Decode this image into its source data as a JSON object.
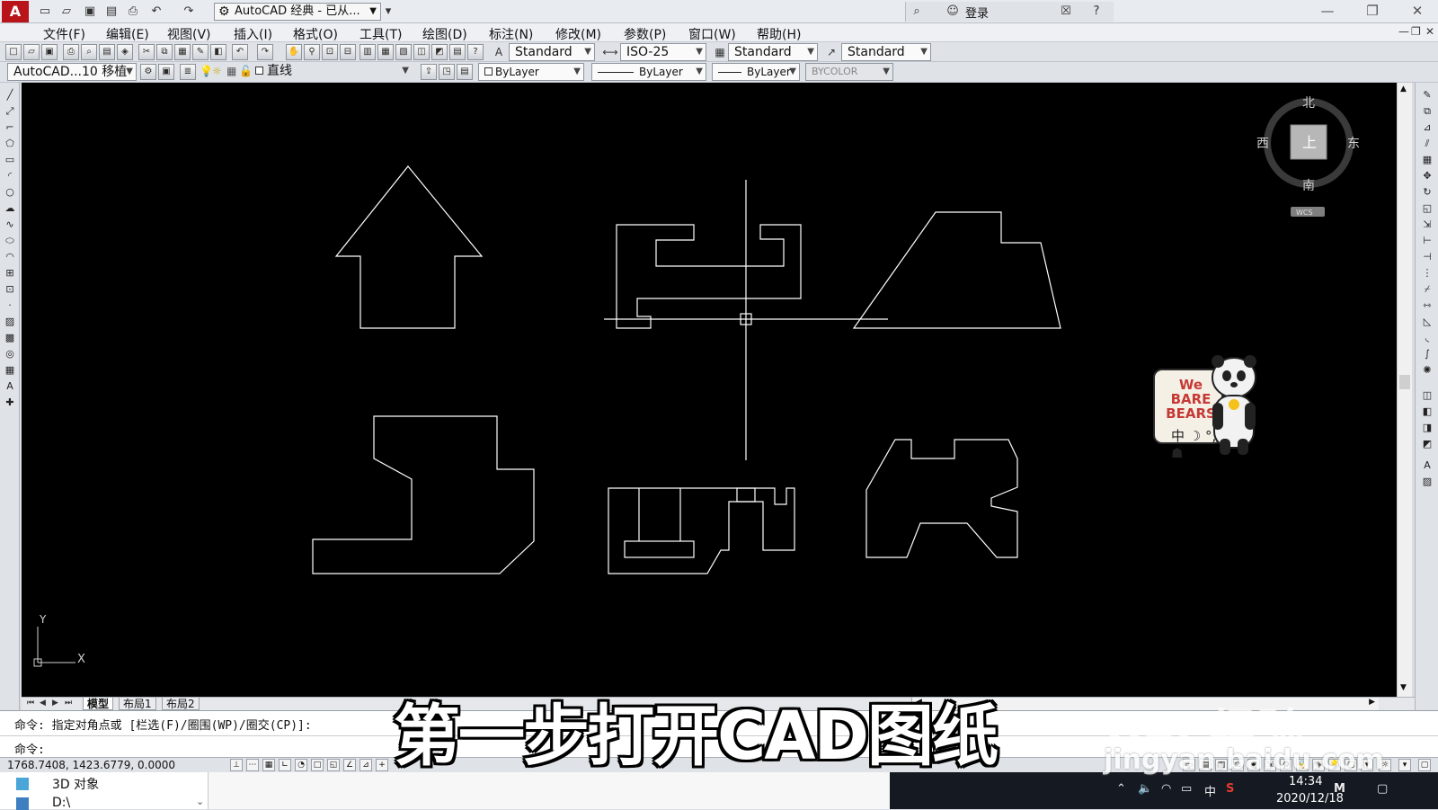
{
  "titlebar": {
    "app_icon": "A",
    "workspace": "AutoCAD 经典 - 已从...",
    "login": "登录",
    "win_controls": [
      "—",
      "❐",
      "✕"
    ]
  },
  "menu": {
    "items": [
      "文件(F)",
      "编辑(E)",
      "视图(V)",
      "插入(I)",
      "格式(O)",
      "工具(T)",
      "绘图(D)",
      "标注(N)",
      "修改(M)",
      "参数(P)",
      "窗口(W)",
      "帮助(H)"
    ],
    "doc_controls": [
      "—",
      "❐",
      "✕"
    ]
  },
  "styles_toolbar": {
    "text_style": "Standard",
    "dim_style": "ISO-25",
    "table_style": "Standard",
    "multileader_style": "Standard"
  },
  "layers_toolbar": {
    "workspace_combo": "AutoCAD...10 移植",
    "layer_combo": "直线",
    "color": "ByLayer",
    "linetype": "ByLayer",
    "lineweight": "ByLayer",
    "plot_style": "BYCOLOR"
  },
  "viewcube": {
    "north": "北",
    "south": "南",
    "west": "西",
    "east": "东",
    "face": "上",
    "wcs": "WCS"
  },
  "ucs": {
    "x": "X",
    "y": "Y"
  },
  "layout_tabs": [
    "模型",
    "布局1",
    "布局2"
  ],
  "command": {
    "history": "命令: 指定对角点或 [栏选(F)/圈围(WP)/圈交(CP)]:",
    "prompt": "命令:"
  },
  "status": {
    "coordinates": "1768.7408, 1423.6779, 0.0000"
  },
  "explorer": {
    "items": [
      "3D 对象",
      "D:\\"
    ]
  },
  "taskbar": {
    "ime": "中",
    "time": "14:34",
    "date": "2020/12/18"
  },
  "overlay": {
    "subtitle": "第一步打开CAD图纸",
    "watermark_logo": "Bai 经验",
    "watermark_url": "jingyan.baidu.com",
    "sticker_brand": "We BARE BEARS",
    "sticker_text": "中 ☽ °, ☗"
  },
  "colors": {
    "canvas_bg": "#000000",
    "drawing_line": "#ffffff",
    "accent_red": "#b8141a"
  }
}
